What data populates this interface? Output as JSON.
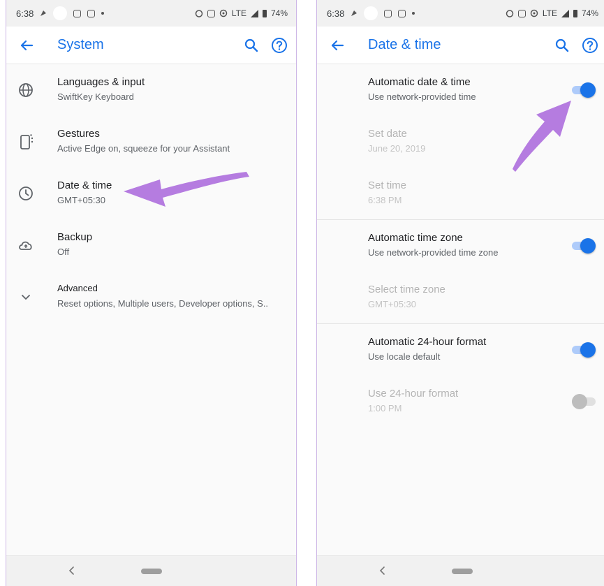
{
  "left": {
    "status": {
      "time": "6:38",
      "battery": "74%",
      "network": "LTE"
    },
    "title": "System",
    "items": [
      {
        "title": "Languages & input",
        "subtitle": "SwiftKey Keyboard"
      },
      {
        "title": "Gestures",
        "subtitle": "Active Edge on, squeeze for your Assistant"
      },
      {
        "title": "Date & time",
        "subtitle": "GMT+05:30"
      },
      {
        "title": "Backup",
        "subtitle": "Off"
      },
      {
        "title": "Advanced",
        "subtitle": "Reset options, Multiple users, Developer options, S.."
      }
    ]
  },
  "right": {
    "status": {
      "time": "6:38",
      "battery": "74%",
      "network": "LTE"
    },
    "title": "Date & time",
    "items": [
      {
        "title": "Automatic date & time",
        "subtitle": "Use network-provided time",
        "toggle": "on"
      },
      {
        "title": "Set date",
        "subtitle": "June 20, 2019",
        "disabled": true
      },
      {
        "title": "Set time",
        "subtitle": "6:38 PM",
        "disabled": true
      },
      {
        "title": "Automatic time zone",
        "subtitle": "Use network-provided time zone",
        "toggle": "on"
      },
      {
        "title": "Select time zone",
        "subtitle": "GMT+05:30",
        "disabled": true
      },
      {
        "title": "Automatic 24-hour format",
        "subtitle": "Use locale default",
        "toggle": "on"
      },
      {
        "title": "Use 24-hour format",
        "subtitle": "1:00 PM",
        "toggle": "off",
        "disabled": true
      }
    ]
  },
  "colors": {
    "accent": "#1a73e8",
    "annotation_arrow": "#b57ce0"
  }
}
